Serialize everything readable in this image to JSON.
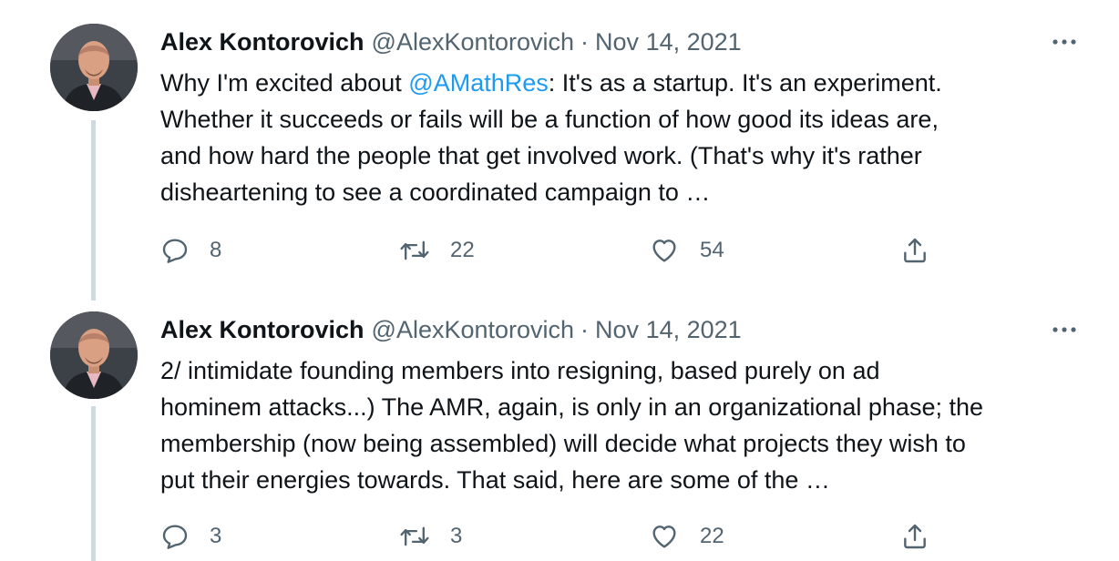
{
  "tweets": [
    {
      "author_name": "Alex Kontorovich",
      "author_handle": "@AlexKontorovich",
      "separator": "·",
      "date": "Nov 14, 2021",
      "text_lines": [
        {
          "before": "Why I'm excited about ",
          "mention": "@AMathRes",
          "after": ": It's as a startup. It's an experiment."
        },
        {
          "text": "Whether it succeeds or fails will be a function of how good its ideas are,"
        },
        {
          "text": "and how hard the people that get involved work. (That's why it's rather"
        },
        {
          "text": "disheartening to see a coordinated campaign to …"
        }
      ],
      "replies": "8",
      "retweets": "22",
      "likes": "54"
    },
    {
      "author_name": "Alex Kontorovich",
      "author_handle": "@AlexKontorovich",
      "separator": "·",
      "date": "Nov 14, 2021",
      "text_lines": [
        {
          "text": "2/ intimidate founding members into resigning, based purely on ad"
        },
        {
          "text": "hominem attacks...) The AMR, again, is only in an organizational phase; the"
        },
        {
          "text": "membership (now being assembled) will decide what projects they wish to"
        },
        {
          "text": "put their energies towards. That said, here are some of the …"
        }
      ],
      "replies": "3",
      "retweets": "3",
      "likes": "22"
    }
  ],
  "icons": {
    "more": "more-horizontal-icon",
    "reply": "reply-icon",
    "retweet": "retweet-icon",
    "like": "heart-icon",
    "share": "share-icon"
  },
  "colors": {
    "text": "#0f1419",
    "secondary": "#536471",
    "mention": "#1d9bf0",
    "thread_line": "#cfd9de"
  }
}
